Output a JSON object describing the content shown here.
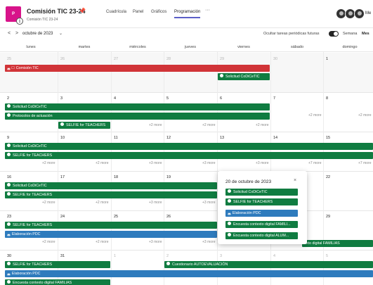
{
  "plan": {
    "icon_text": "P",
    "title": "Comisión TIC 23-24",
    "subtitle": "Comisión TIC 23-24",
    "info_badge": "i"
  },
  "nav": {
    "tabs": [
      "Cuadrícula",
      "Panel",
      "Gráficos",
      "Programación"
    ],
    "active": "Programación",
    "more": "···"
  },
  "header": {
    "me_label": "Me"
  },
  "toolbar": {
    "prev": "<",
    "next": ">",
    "month": "octubre de 2023",
    "chevron": "⌄",
    "hide_recurring": "Ocultar tareas periódicas futuras",
    "toggle_on": true,
    "view_week": "Semana",
    "view_month": "Mes"
  },
  "weekdays": [
    "lunes",
    "martes",
    "miércoles",
    "jueves",
    "viernes",
    "sábado",
    "domingo"
  ],
  "weeks": [
    {
      "dates": [
        "25",
        "26",
        "27",
        "28",
        "29",
        "30",
        "1"
      ],
      "muted": [
        true,
        true,
        true,
        true,
        true,
        true,
        false
      ]
    },
    {
      "dates": [
        "2",
        "3",
        "4",
        "5",
        "6",
        "7",
        "8"
      ],
      "muted": [
        false,
        false,
        false,
        false,
        false,
        false,
        false
      ]
    },
    {
      "dates": [
        "9",
        "10",
        "11",
        "12",
        "13",
        "14",
        "15"
      ],
      "muted": [
        false,
        false,
        false,
        false,
        false,
        false,
        false
      ]
    },
    {
      "dates": [
        "16",
        "17",
        "18",
        "19",
        "20",
        "21",
        "22"
      ],
      "muted": [
        false,
        false,
        false,
        false,
        false,
        false,
        false
      ]
    },
    {
      "dates": [
        "23",
        "24",
        "25",
        "26",
        "27",
        "28",
        "29"
      ],
      "muted": [
        false,
        false,
        false,
        false,
        false,
        false,
        false
      ]
    },
    {
      "dates": [
        "30",
        "31",
        "1",
        "2",
        "3",
        "4",
        "5"
      ],
      "muted": [
        false,
        false,
        true,
        true,
        true,
        true,
        true
      ]
    }
  ],
  "tasks": {
    "comision_tic": "Comisión TIC",
    "solicitud": "Solicitud CoDiCeTIC",
    "protocolos": "Protocolos de actuación",
    "selfie": "SELFIE for TEACHERS",
    "elaboracion": "Elaboración PDC",
    "cuestionario": "Cuestionario AUTOEVALUACIÓN",
    "encuesta_familias": "Encuesta contexto digital FAMILIAS",
    "familias_tail": "exto digital FAMILIAS"
  },
  "more_label": "+2 more",
  "more_label_3": "+3 more",
  "more_label_7": "+7 more",
  "popup": {
    "title": "20 de octubre de 2023",
    "close": "×",
    "items": [
      "Solicitud CoDiCeTIC",
      "SELFIE for TEACHERS",
      "Elaboración PDC",
      "Encuesta contexto digital FAMILI...",
      "Encuesta contexto digital ALUM..."
    ]
  },
  "colors": {
    "green": "#107c41",
    "red": "#d13438",
    "blue": "#2e7bbd",
    "accent": "#5b5fc7",
    "plan_icon": "#d8138a"
  }
}
